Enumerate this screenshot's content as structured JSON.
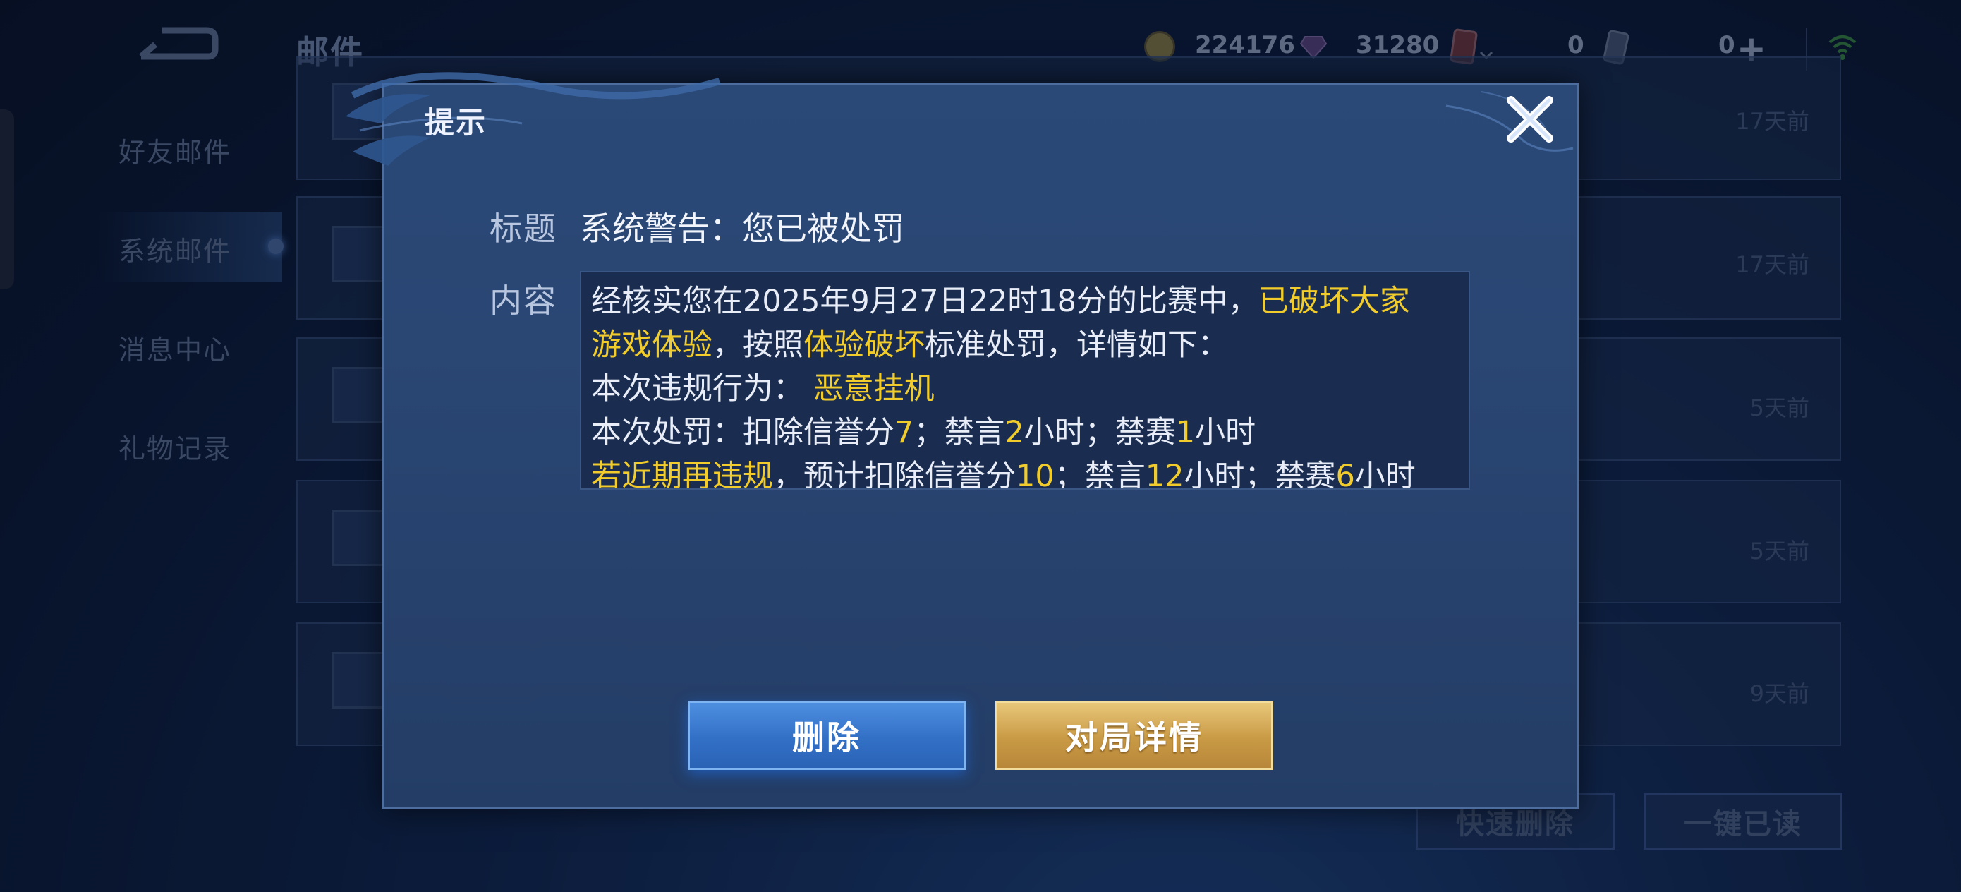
{
  "header": {
    "title": "邮件",
    "gold": "224176",
    "gems": "31280",
    "cards": "0",
    "tickets": "0"
  },
  "sidebar": {
    "items": [
      {
        "label": "好友邮件"
      },
      {
        "label": "系统邮件"
      },
      {
        "label": "消息中心"
      },
      {
        "label": "礼物记录"
      }
    ]
  },
  "mail_list": {
    "times": [
      "17天前",
      "17天前",
      "5天前",
      "5天前",
      "9天前"
    ]
  },
  "bottom_actions": {
    "quick_delete": "快速删除",
    "mark_all_read": "一键已读"
  },
  "dialog": {
    "header": "提示",
    "title_label": "标题",
    "title_value": "系统警告：您已被处罚",
    "content_label": "内容",
    "content": {
      "line1_a": "经核实您在2025年9月27日22时18分的比赛中，",
      "line1_b": "已破坏大家",
      "line2_a": "游戏体验",
      "line2_b": "，按照",
      "line2_c": "体验破坏",
      "line2_d": "标准处罚，详情如下：",
      "line3_a": "本次违规行为：",
      "line3_b": "恶意挂机",
      "line4_a": "本次处罚：扣除信誉分",
      "line4_b": "7",
      "line4_c": "；禁言",
      "line4_d": "2",
      "line4_e": "小时；禁赛",
      "line4_f": "1",
      "line4_g": "小时",
      "line5_a": "若近期再违规",
      "line5_b": "，预计扣除信誉分",
      "line5_c": "10",
      "line5_d": "；禁言",
      "line5_e": "12",
      "line5_f": "小时；禁赛",
      "line5_g": "6",
      "line5_h": "小时"
    },
    "delete_label": "删除",
    "details_label": "对局详情"
  },
  "colors": {
    "highlight": "#f2cc2a",
    "delete_button": "#3270c6",
    "details_button": "#c99a45"
  }
}
